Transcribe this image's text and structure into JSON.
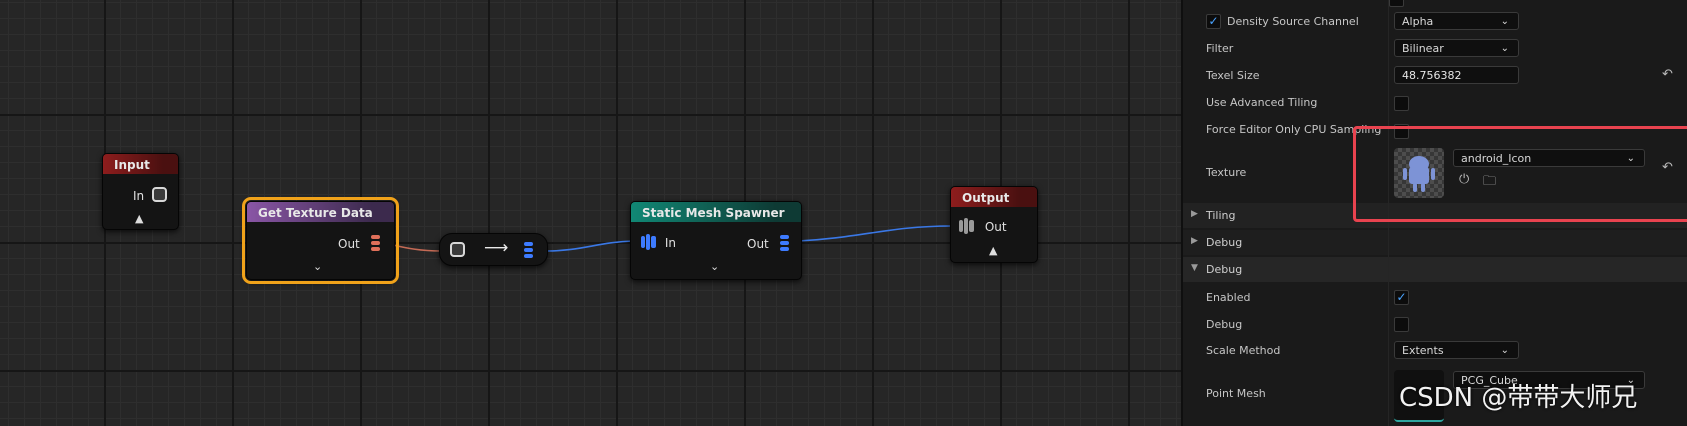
{
  "nodes": {
    "input": {
      "title": "Input",
      "pin_in": "In"
    },
    "get_texture": {
      "title": "Get Texture Data",
      "pin_out": "Out"
    },
    "spawner": {
      "title": "Static Mesh Spawner",
      "pin_in": "In",
      "pin_out": "Out"
    },
    "output": {
      "title": "Output",
      "pin_out": "Out"
    }
  },
  "details": {
    "density_source_channel": {
      "label": "Density Source Channel",
      "value": "Alpha",
      "checked": true
    },
    "filter": {
      "label": "Filter",
      "value": "Bilinear"
    },
    "texel_size": {
      "label": "Texel Size",
      "value": "48.756382"
    },
    "use_advanced_tiling": {
      "label": "Use Advanced Tiling"
    },
    "force_cpu": {
      "label": "Force Editor Only CPU Sampling"
    },
    "texture": {
      "label": "Texture",
      "value": "android_Icon"
    },
    "tiling_cat": {
      "label": "Tiling"
    },
    "debug_cat": {
      "label": "Debug"
    },
    "debug_cat_open": {
      "label": "Debug"
    },
    "enabled": {
      "label": "Enabled",
      "checked": true
    },
    "debug": {
      "label": "Debug"
    },
    "scale_method": {
      "label": "Scale Method",
      "value": "Extents"
    },
    "point_mesh": {
      "label": "Point Mesh",
      "value": "PCG_Cube"
    }
  },
  "icons": {
    "reset": "reset-arrow-icon",
    "browse": "browse-icon",
    "use_selected": "use-selected-icon"
  },
  "colors": {
    "selection": "#f0a21a",
    "highlight": "#e8434f",
    "pin_blue": "#3d7bff",
    "pin_red": "#e0705a"
  },
  "watermark": "CSDN @带带大师兄"
}
